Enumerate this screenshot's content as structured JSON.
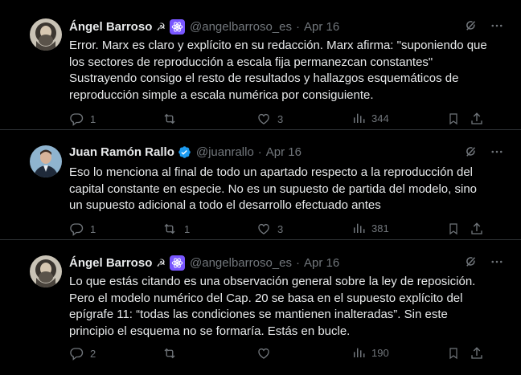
{
  "tweets": [
    {
      "name": "Ángel Barroso",
      "handle": "@angelbarroso_es",
      "dot": "·",
      "date": "Apr 16",
      "text": "Error. Marx es claro y explícito en su redacción. Marx afirma: \"suponiendo que los sectores de reproducción a escala fija permanezcan constantes\" Sustrayendo consigo el resto de resultados y hallazgos esquemáticos de reproducción simple a escala numérica por consiguiente.",
      "replies": "1",
      "retweets": "",
      "likes": "3",
      "views": "344"
    },
    {
      "name": "Juan Ramón Rallo",
      "handle": "@juanrallo",
      "dot": "·",
      "date": "Apr 16",
      "text": "Eso lo menciona al final de todo un apartado respecto a la reproducción del capital constante en especie. No es un supuesto de partida del modelo, sino un supuesto adicional a todo el desarrollo efectuado antes",
      "replies": "1",
      "retweets": "1",
      "likes": "3",
      "views": "381"
    },
    {
      "name": "Ángel Barroso",
      "handle": "@angelbarroso_es",
      "dot": "·",
      "date": "Apr 16",
      "text": "Lo que estás citando es una observación general sobre la ley de reposición. Pero el modelo numérico del Cap. 20 se basa en el supuesto explícito del epígrafe 11: “todas las condiciones se mantienen inalteradas”. Sin este principio el esquema no se formaría. Estás en bucle.",
      "replies": "2",
      "retweets": "",
      "likes": "",
      "views": "190"
    }
  ],
  "icons": {
    "reply": "reply-icon",
    "retweet": "retweet-icon",
    "like": "heart-icon",
    "views": "views-icon",
    "bookmark": "bookmark-icon",
    "share": "share-icon",
    "grok": "grok-icon",
    "more": "more-icon"
  },
  "colors": {
    "background": "#000000",
    "text": "#e7e9ea",
    "secondary": "#71767b",
    "verified": "#1d9bf0",
    "badge": "#7856ff"
  }
}
